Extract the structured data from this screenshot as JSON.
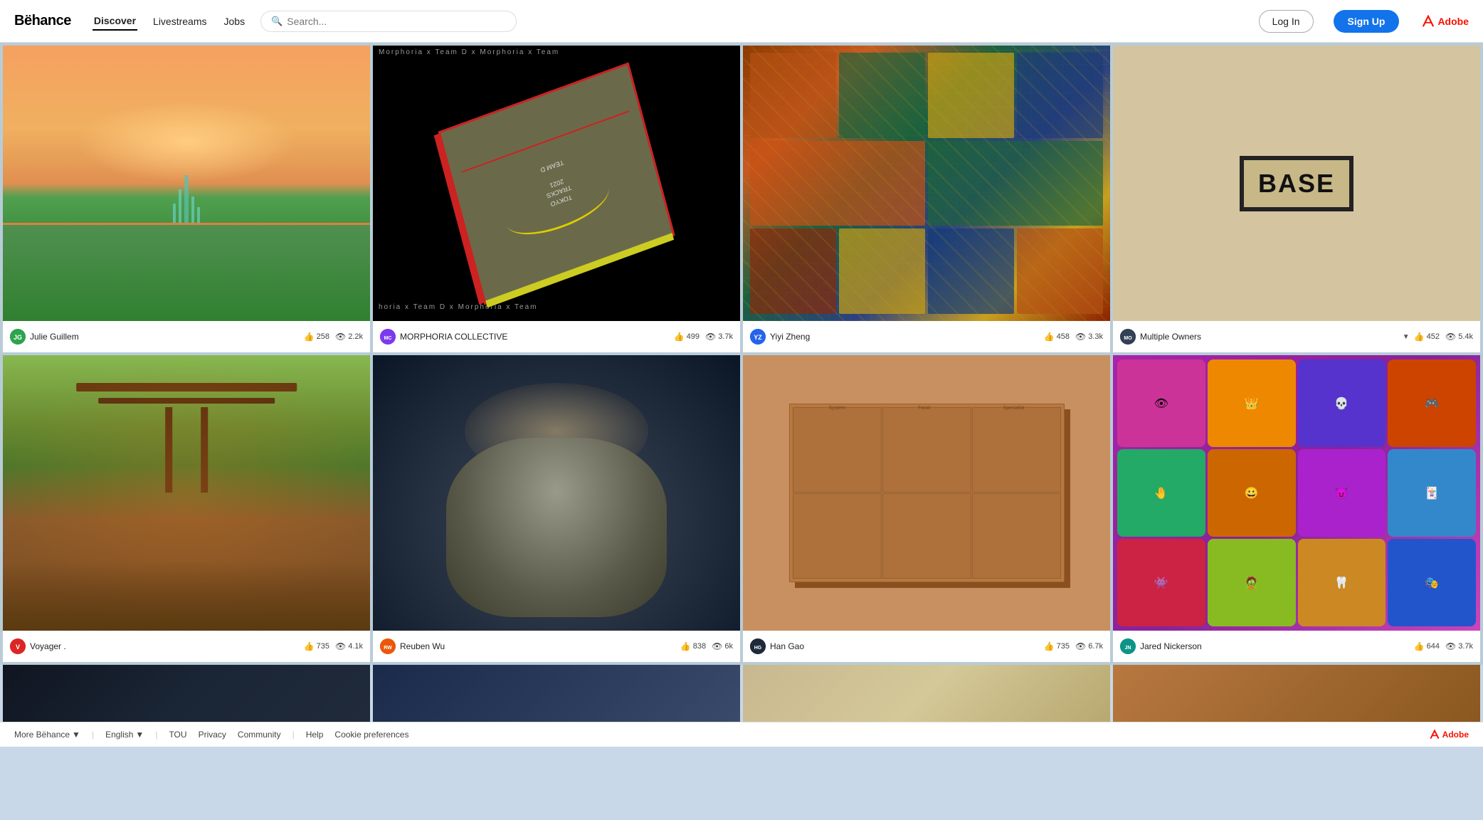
{
  "nav": {
    "logo": "Bëhance",
    "links": [
      "Discover",
      "Livestreams",
      "Jobs"
    ],
    "active_link": "Discover",
    "search_placeholder": "Search...",
    "login_label": "Log In",
    "signup_label": "Sign Up",
    "adobe_label": "Adobe"
  },
  "grid": {
    "cards": [
      {
        "id": 1,
        "author": "Julie Guillem",
        "avatar_initials": "JG",
        "avatar_color": "av-green",
        "likes": "258",
        "views": "2.2k",
        "theme": "orange-landscape"
      },
      {
        "id": 2,
        "author": "MORPHORIA COLLECTIVE",
        "avatar_initials": "MC",
        "avatar_color": "av-morph",
        "likes": "499",
        "views": "3.7k",
        "theme": "book-dark"
      },
      {
        "id": 3,
        "author": "Yiyi Zheng",
        "avatar_initials": "YZ",
        "avatar_color": "av-blue",
        "likes": "458",
        "views": "3.3k",
        "theme": "chinese-arch"
      },
      {
        "id": 4,
        "author": "Multiple Owners",
        "avatar_initials": "",
        "avatar_color": "av-dark",
        "likes": "452",
        "views": "5.4k",
        "theme": "base-sign",
        "has_dropdown": true
      },
      {
        "id": 5,
        "author": "Voyager .",
        "avatar_initials": "V",
        "avatar_color": "av-red",
        "likes": "735",
        "views": "4.1k",
        "theme": "forest"
      },
      {
        "id": 6,
        "author": "Reuben Wu",
        "avatar_initials": "RW",
        "avatar_color": "av-orange",
        "likes": "838",
        "views": "6k",
        "theme": "dark-creature"
      },
      {
        "id": 7,
        "author": "Han Gao",
        "avatar_initials": "HG",
        "avatar_color": "av-dark",
        "likes": "735",
        "views": "6.7k",
        "theme": "brown-box"
      },
      {
        "id": 8,
        "author": "Jared Nickerson",
        "avatar_initials": "JN",
        "avatar_color": "av-teal",
        "likes": "644",
        "views": "3.7k",
        "theme": "colorful-monsters"
      }
    ]
  },
  "footer": {
    "more_behance": "More Bëhance",
    "language": "English",
    "tou": "TOU",
    "privacy": "Privacy",
    "community": "Community",
    "help": "Help",
    "cookie_preferences": "Cookie preferences",
    "adobe_label": "Adobe"
  }
}
